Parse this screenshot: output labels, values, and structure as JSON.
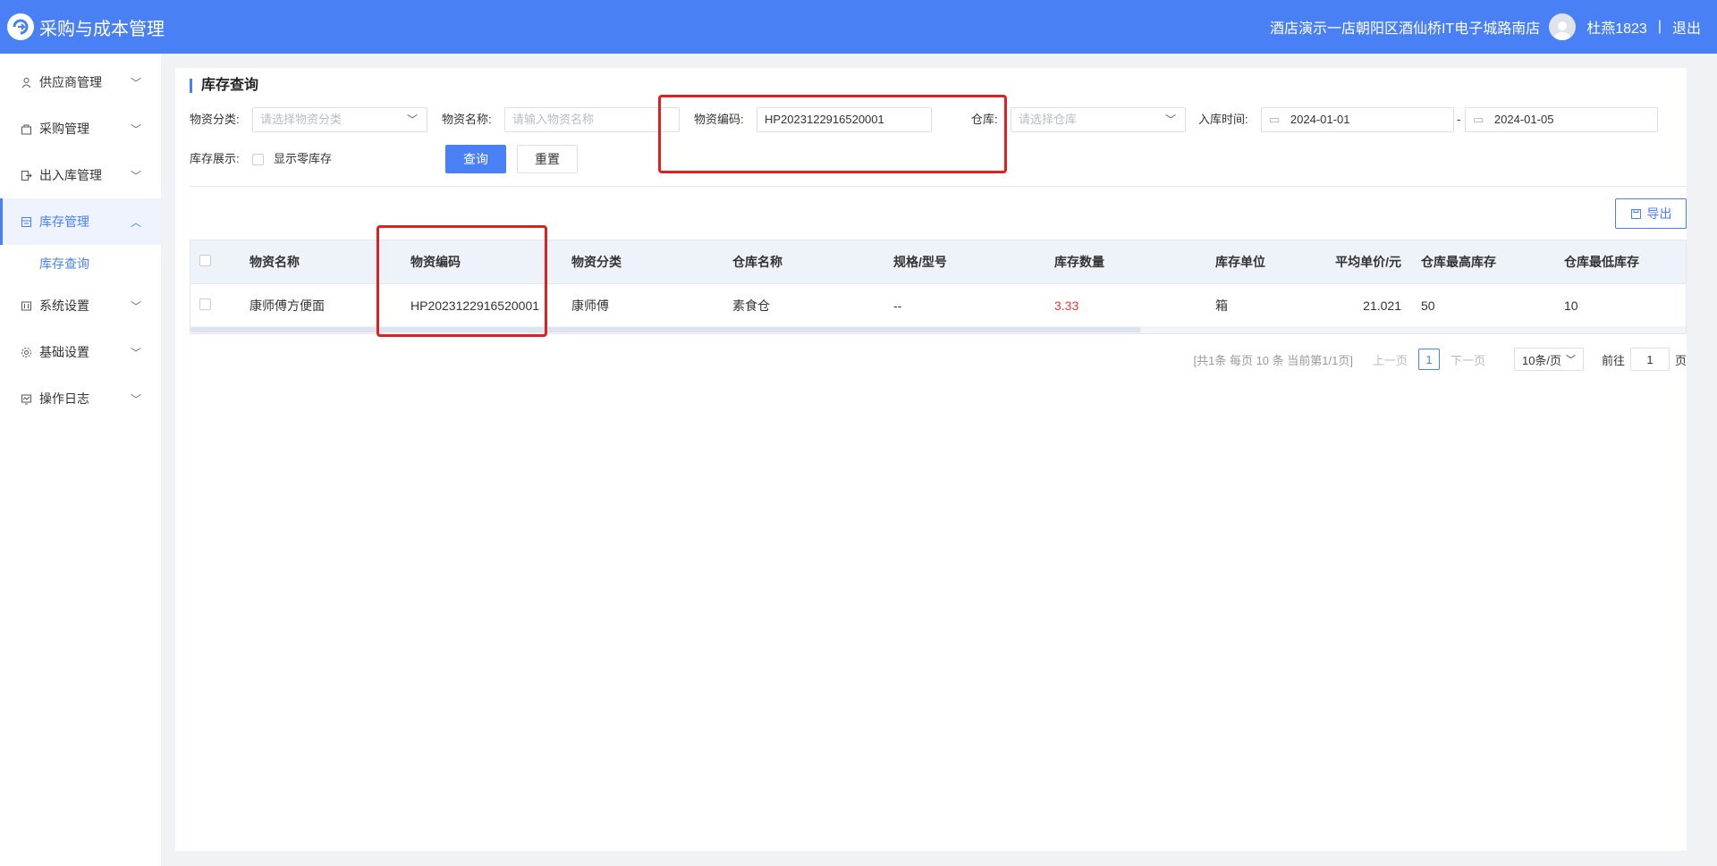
{
  "header": {
    "title": "采购与成本管理",
    "store": "酒店演示一店朝阳区酒仙桥IT电子城路南店",
    "user": "杜燕1823",
    "separator": "|",
    "logout": "退出"
  },
  "sidebar": {
    "items": [
      {
        "label": "供应商管理",
        "icon": "supplier-icon"
      },
      {
        "label": "采购管理",
        "icon": "cart-icon"
      },
      {
        "label": "出入库管理",
        "icon": "inout-icon"
      },
      {
        "label": "库存管理",
        "icon": "inventory-icon",
        "active": true
      },
      {
        "label": "系统设置",
        "icon": "settings-icon"
      },
      {
        "label": "基础设置",
        "icon": "gear-icon"
      },
      {
        "label": "操作日志",
        "icon": "log-icon"
      }
    ],
    "submenu": "库存查询"
  },
  "page": {
    "title": "库存查询"
  },
  "filters": {
    "category_label": "物资分类:",
    "category_placeholder": "请选择物资分类",
    "name_label": "物资名称:",
    "name_placeholder": "请输入物资名称",
    "code_label": "物资编码:",
    "code_value": "HP2023122916520001",
    "warehouse_label": "仓库:",
    "warehouse_placeholder": "请选择仓库",
    "date_label": "入库时间:",
    "date_start": "2024-01-01",
    "date_sep": "-",
    "date_end": "2024-01-05",
    "display_label": "库存展示:",
    "zero_stock_label": "显示零库存",
    "query_button": "查询",
    "reset_button": "重置"
  },
  "export_button": "导出",
  "table": {
    "columns": [
      "物资名称",
      "物资编码",
      "物资分类",
      "仓库名称",
      "规格/型号",
      "库存数量",
      "库存单位",
      "平均单价/元",
      "仓库最高库存",
      "仓库最低库存"
    ],
    "rows": [
      {
        "name": "康师傅方便面",
        "code": "HP2023122916520001",
        "category": "康师傅",
        "warehouse": "素食仓",
        "spec": "--",
        "qty": "3.33",
        "unit": "箱",
        "price": "21.021",
        "max": "50",
        "min": "10"
      }
    ]
  },
  "pager": {
    "info": "[共1条 每页 10 条 当前第1/1页]",
    "prev": "上一页",
    "current": "1",
    "next": "下一页",
    "size": "10条/页",
    "goto_label": "前往",
    "goto_value": "1",
    "page_label": "页"
  },
  "colors": {
    "primary": "#4a80f5",
    "highlight": "#e02020",
    "qty": "#e53935"
  }
}
